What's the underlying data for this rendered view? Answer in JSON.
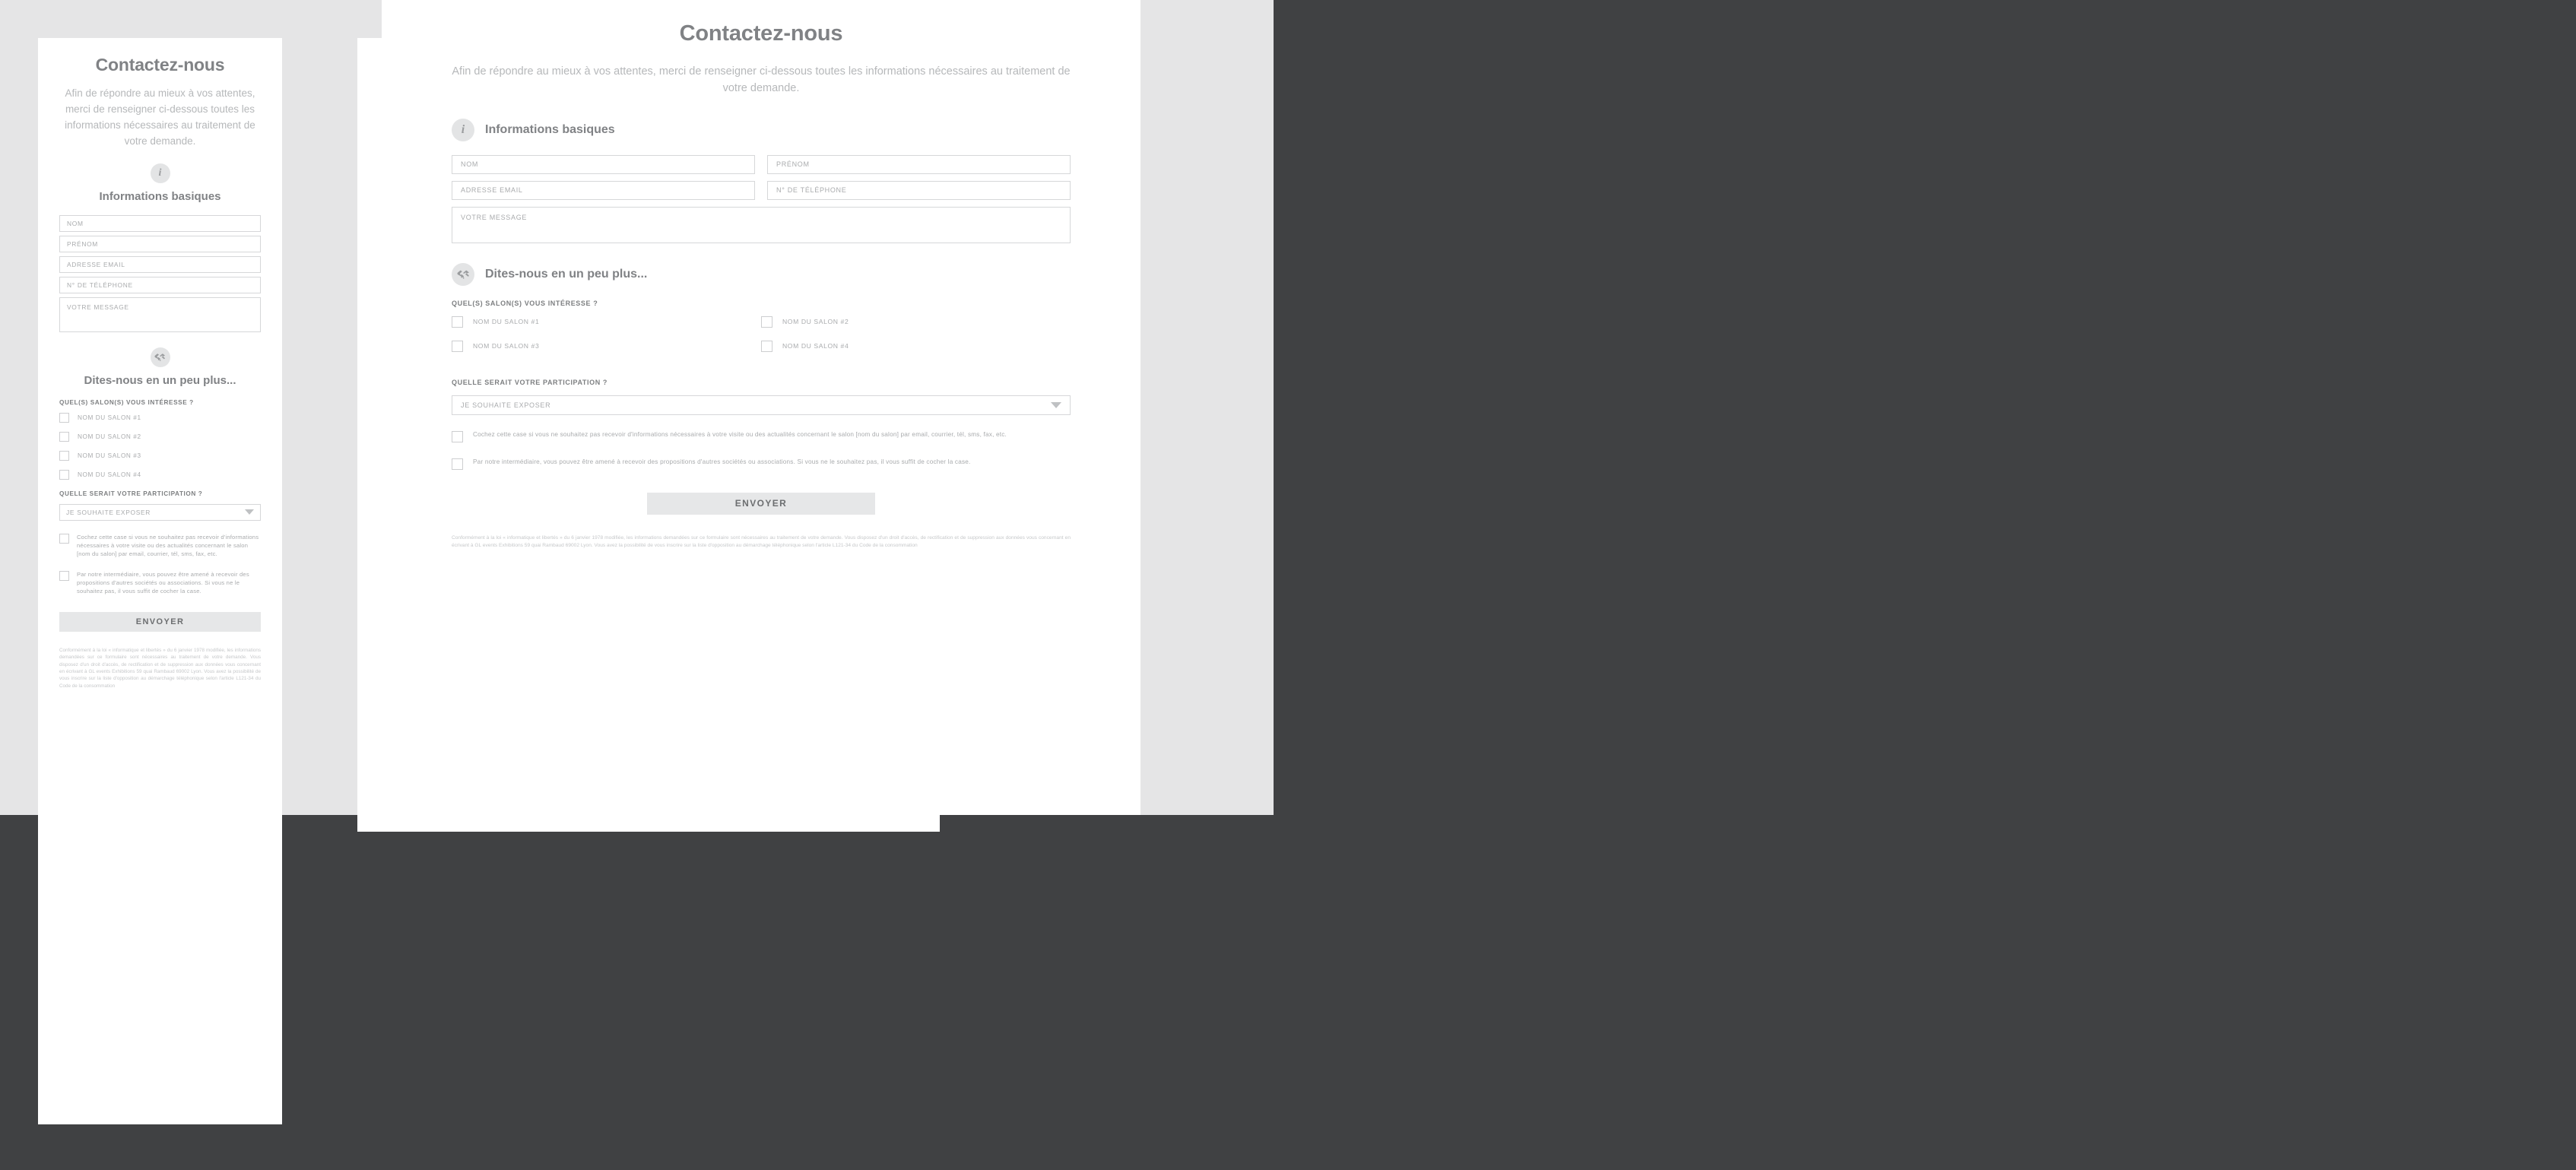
{
  "colors": {
    "page_background": "#404143",
    "card_background": "#ffffff",
    "shell_background": "#e5e5e6",
    "heading": "#808285",
    "muted_text": "#b6b8ba",
    "field_border": "#d6d7d9",
    "submit_background": "#e6e7e8",
    "badge_background": "#e3e4e5"
  },
  "form": {
    "title": "Contactez-nous",
    "intro": "Afin de répondre au mieux à vos attentes, merci de renseigner ci-dessous toutes les informations nécessaires au traitement de votre demande.",
    "section_basic": {
      "icon": "info-icon",
      "heading": "Informations basiques",
      "fields": [
        {
          "name": "nom",
          "placeholder": "NOM"
        },
        {
          "name": "prenom",
          "placeholder": "PRÉNOM"
        },
        {
          "name": "email",
          "placeholder": "ADRESSE EMAIL"
        },
        {
          "name": "telephone",
          "placeholder": "N° DE TÉLÉPHONE"
        }
      ],
      "message": {
        "name": "message",
        "placeholder": "VOTRE MESSAGE"
      }
    },
    "section_more": {
      "icon": "handshake-icon",
      "heading": "Dites-nous en un peu plus...",
      "salon_question": "QUEL(S) SALON(S) VOUS INTÉRESSE ?",
      "salons": [
        "NOM DU SALON #1",
        "NOM DU SALON #2",
        "NOM DU SALON #3",
        "NOM DU SALON #4"
      ],
      "participation_question": "QUELLE SERAIT VOTRE PARTICIPATION ?",
      "participation_selected": "JE SOUHAITE EXPOSER",
      "participation_options": [
        "JE SOUHAITE EXPOSER"
      ]
    },
    "consents": [
      "Cochez cette case si vous ne souhaitez pas recevoir d'informations nécessaires à votre visite ou des actualités concernant le salon [nom du salon] par email, courrier, tél, sms, fax, etc.",
      "Par notre intermédiaire, vous pouvez être amené à recevoir des propositions d'autres sociétés ou associations. Si vous ne le souhaitez pas, il vous suffit de cocher la case."
    ],
    "submit_label": "ENVOYER",
    "legal": "Conformément à la loi « informatique et libertés » du 6 janvier 1978 modifiée, les informations demandées sur ce formulaire sont nécessaires au traitement de votre demande. Vous disposez d'un droit d'accès, de rectification et de suppression aux données vous concernant en écrivant à GL events Exhibitions 59 quai Rambaud 69002 Lyon. Vous avez la possibilité de vous inscrire sur la liste d'opposition au démarchage téléphonique selon l'article L121-34 du Code de la consommation"
  }
}
